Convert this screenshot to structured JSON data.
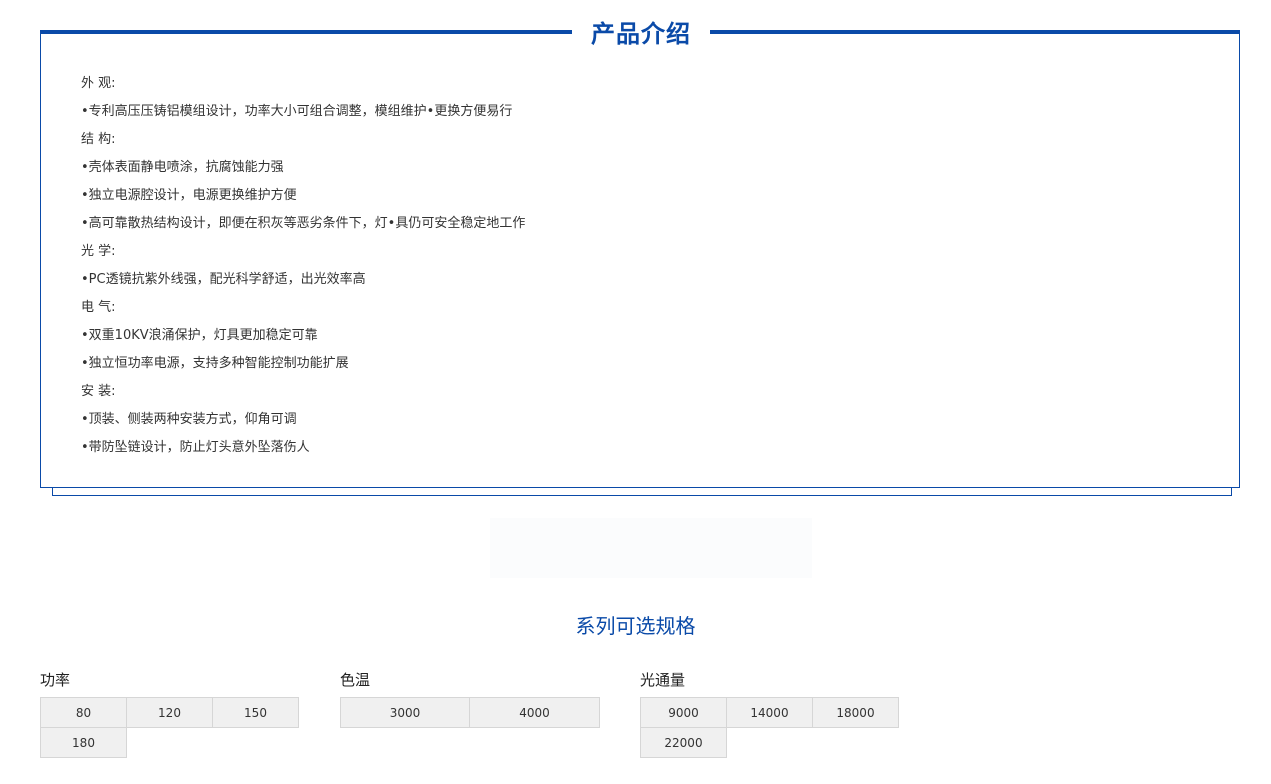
{
  "intro": {
    "title": "产品介绍",
    "lines": [
      "外  观:",
      "•专利高压压铸铝模组设计，功率大小可组合调整，模组维护•更换方便易行",
      "结  构:",
      "•壳体表面静电喷涂，抗腐蚀能力强",
      "•独立电源腔设计，电源更换维护方便",
      "•高可靠散热结构设计，即便在积灰等恶劣条件下，灯•具仍可安全稳定地工作",
      "光  学:",
      "•PC透镜抗紫外线强，配光科学舒适，出光效率高",
      "电  气:",
      "•双重10KV浪涌保护，灯具更加稳定可靠",
      "•独立恒功率电源，支持多种智能控制功能扩展",
      "安  装:",
      "•顶装、侧装两种安装方式，仰角可调",
      "•带防坠链设计，防止灯头意外坠落伤人"
    ]
  },
  "specs": {
    "title": "系列可选规格",
    "groups": [
      {
        "name": "功率",
        "options": [
          "80",
          "120",
          "150",
          "180"
        ]
      },
      {
        "name": "色温",
        "options": [
          "3000",
          "4000"
        ]
      },
      {
        "name": "光通量",
        "options": [
          "9000",
          "14000",
          "18000",
          "22000"
        ]
      }
    ]
  },
  "colors": {
    "accent": "#0a4aa8",
    "option_bg": "#f0f0f0",
    "option_border": "#d6d6d6"
  }
}
